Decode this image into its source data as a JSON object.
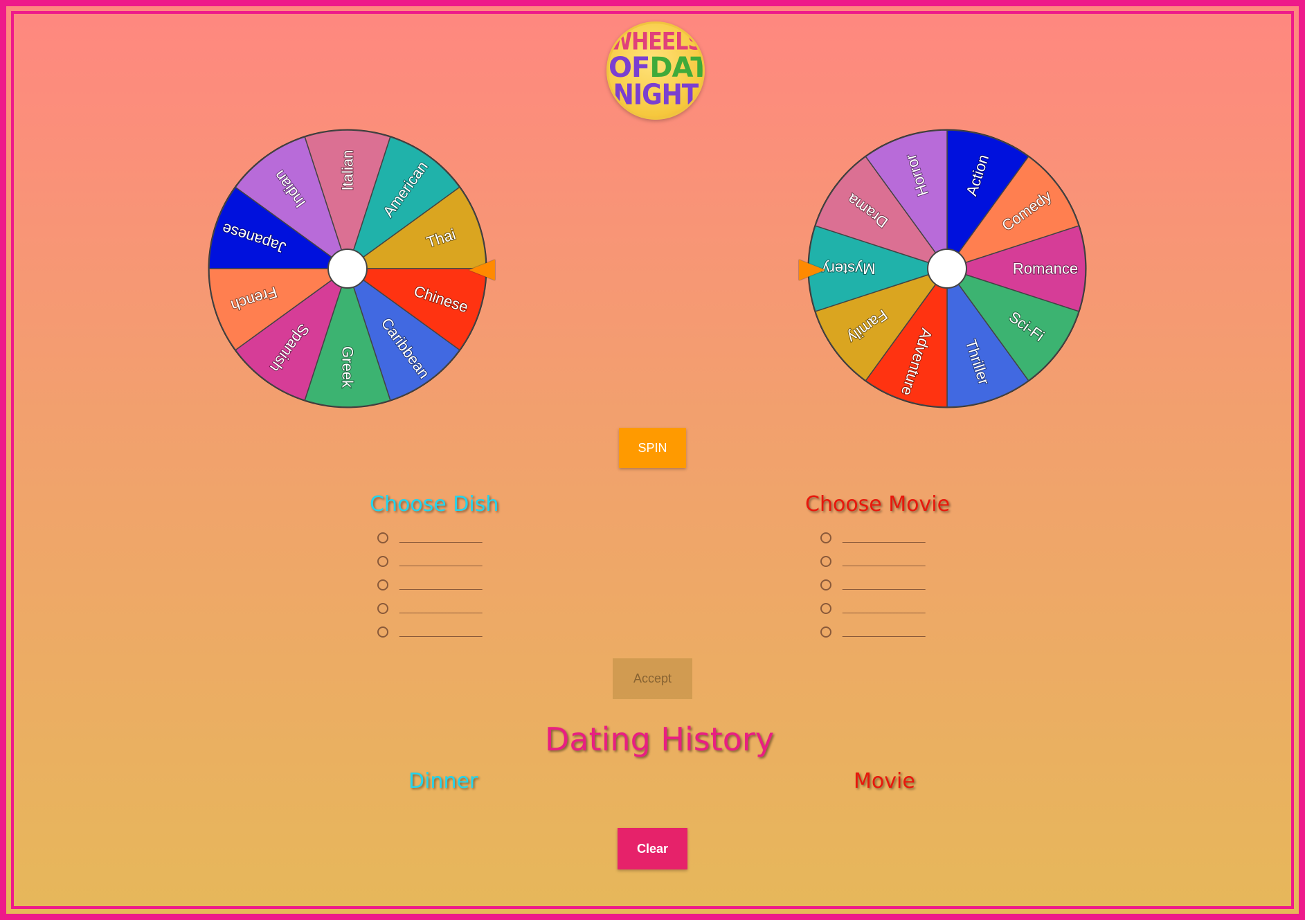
{
  "logo": {
    "line1": "WHEELS",
    "of": "OF",
    "date": "DATE",
    "line3": "NIGHT"
  },
  "wheels": {
    "dish": {
      "segments": [
        {
          "label": "Italian",
          "color": "#db7093"
        },
        {
          "label": "American",
          "color": "#20b2aa"
        },
        {
          "label": "Thai",
          "color": "#daa520"
        },
        {
          "label": "Chinese",
          "color": "#ff3311"
        },
        {
          "label": "Caribbean",
          "color": "#4169e1"
        },
        {
          "label": "Greek",
          "color": "#3cb371"
        },
        {
          "label": "Spanish",
          "color": "#d63d97"
        },
        {
          "label": "French",
          "color": "#ff7f50"
        },
        {
          "label": "Japanese",
          "color": "#0011dd"
        },
        {
          "label": "Indian",
          "color": "#b86bd9"
        }
      ]
    },
    "movie": {
      "segments": [
        {
          "label": "Action",
          "color": "#0011dd"
        },
        {
          "label": "Comedy",
          "color": "#ff7f50"
        },
        {
          "label": "Romance",
          "color": "#d63d97"
        },
        {
          "label": "Sci-Fi",
          "color": "#3cb371"
        },
        {
          "label": "Thriller",
          "color": "#4169e1"
        },
        {
          "label": "Adventure",
          "color": "#ff3311"
        },
        {
          "label": "Family",
          "color": "#daa520"
        },
        {
          "label": "Mystery",
          "color": "#20b2aa"
        },
        {
          "label": "Drama",
          "color": "#db7093"
        },
        {
          "label": "Horror",
          "color": "#b86bd9"
        }
      ]
    }
  },
  "buttons": {
    "spin": "SPIN",
    "accept": "Accept",
    "clear": "Clear"
  },
  "choose": {
    "dish": {
      "title": "Choose Dish",
      "options": [
        "_______________",
        "_______________",
        "_______________",
        "_______________",
        "_______________"
      ]
    },
    "movie": {
      "title": "Choose Movie",
      "options": [
        "_______________",
        "_______________",
        "_______________",
        "_______________",
        "_______________"
      ]
    }
  },
  "history": {
    "title": "Dating History",
    "dinner_label": "Dinner",
    "movie_label": "Movie"
  }
}
